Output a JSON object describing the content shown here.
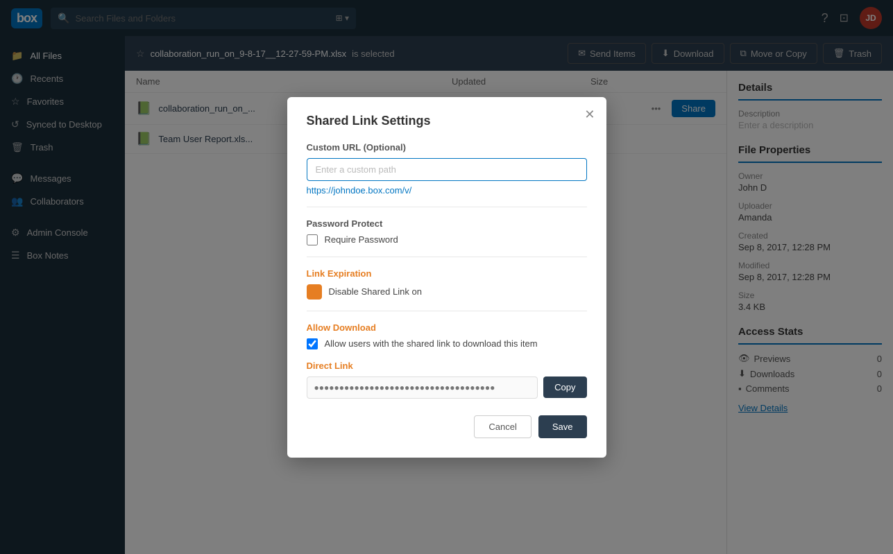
{
  "header": {
    "logo": "box",
    "search_placeholder": "Search Files and Folders",
    "avatar_initials": "JD"
  },
  "sidebar": {
    "items": [
      {
        "id": "all-files",
        "label": "All Files",
        "icon": "📁",
        "active": true
      },
      {
        "id": "recents",
        "label": "Recents",
        "icon": "🕐"
      },
      {
        "id": "favorites",
        "label": "Favorites",
        "icon": "⭐"
      },
      {
        "id": "synced",
        "label": "Synced to Desktop",
        "icon": "🔄"
      },
      {
        "id": "trash",
        "label": "Trash",
        "icon": "🗑"
      },
      {
        "id": "messages",
        "label": "Messages",
        "icon": "💬"
      },
      {
        "id": "collaborators",
        "label": "Collaborators",
        "icon": "👥"
      },
      {
        "id": "admin",
        "label": "Admin Console",
        "icon": "⚙"
      },
      {
        "id": "box-notes",
        "label": "Box Notes",
        "icon": "📝"
      }
    ]
  },
  "toolbar": {
    "selected_file": "collaboration_run_on_9-8-17__12-27-59-PM.xlsx",
    "selected_suffix": "is selected",
    "send_items_label": "Send Items",
    "download_label": "Download",
    "move_copy_label": "Move or Copy",
    "trash_label": "Trash"
  },
  "file_table": {
    "columns": [
      "Name",
      "Updated",
      "Size"
    ],
    "rows": [
      {
        "name": "collaboration_run_on_...",
        "icon": "📗"
      },
      {
        "name": "Team User Report.xls...",
        "icon": "📗"
      }
    ],
    "share_button_label": "Share"
  },
  "right_panel": {
    "title": "Details",
    "description_label": "Description",
    "description_placeholder": "Enter a description",
    "file_properties_title": "File Properties",
    "owner_label": "Owner",
    "owner_value": "John D",
    "uploader_label": "Uploader",
    "uploader_value": "Amanda",
    "created_label": "Created",
    "created_value": "Sep 8, 2017, 12:28 PM",
    "modified_label": "Modified",
    "modified_value": "Sep 8, 2017, 12:28 PM",
    "size_label": "Size",
    "size_value": "3.4 KB",
    "access_stats_title": "Access Stats",
    "stats": [
      {
        "icon": "👁",
        "label": "Previews",
        "value": "0"
      },
      {
        "icon": "⬇",
        "label": "Downloads",
        "value": "0"
      },
      {
        "icon": "▪",
        "label": "Comments",
        "value": "0"
      }
    ],
    "view_details_label": "View Details"
  },
  "modal": {
    "title": "Shared Link Settings",
    "custom_url_label": "Custom URL (Optional)",
    "custom_url_placeholder": "Enter a custom path",
    "url_hint": "https://johndoe.box.com/v/",
    "password_protect_label": "Password Protect",
    "require_password_label": "Require Password",
    "link_expiration_label": "Link Expiration",
    "disable_shared_link_label": "Disable Shared Link on",
    "allow_download_label": "Allow Download",
    "allow_download_checkbox_label": "Allow users with the shared link to download this item",
    "direct_link_label": "Direct Link",
    "direct_link_placeholder": "●●●●●●●●●●●●●●●●●●●●●●●●●●●●●●●●●●●●",
    "copy_button_label": "Copy",
    "cancel_button_label": "Cancel",
    "save_button_label": "Save"
  }
}
